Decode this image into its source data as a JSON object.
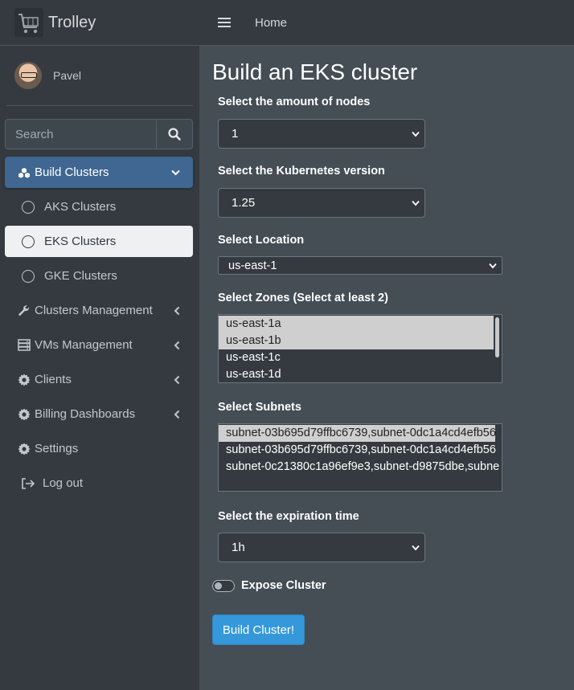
{
  "app": {
    "name": "Trolley"
  },
  "user": {
    "name": "Pavel"
  },
  "search": {
    "placeholder": "Search"
  },
  "sidebar": {
    "items": [
      {
        "label": "Build Clusters",
        "icon": "cubes-icon"
      },
      {
        "label": "AKS Clusters",
        "icon": "circle-icon"
      },
      {
        "label": "EKS Clusters",
        "icon": "circle-icon"
      },
      {
        "label": "GKE Clusters",
        "icon": "circle-icon"
      },
      {
        "label": "Clusters Management",
        "icon": "wrench-icon"
      },
      {
        "label": "VMs Management",
        "icon": "server-icon"
      },
      {
        "label": "Clients",
        "icon": "gear-icon"
      },
      {
        "label": "Billing Dashboards",
        "icon": "gear-icon"
      },
      {
        "label": "Settings",
        "icon": "gear-icon"
      },
      {
        "label": "Log out",
        "icon": "logout-icon"
      }
    ]
  },
  "topbar": {
    "home": "Home"
  },
  "page": {
    "title": "Build an EKS cluster",
    "nodes": {
      "label": "Select the amount of nodes",
      "value": "1"
    },
    "version": {
      "label": "Select the Kubernetes version",
      "value": "1.25"
    },
    "location": {
      "label": "Select Location",
      "value": "us-east-1"
    },
    "zones": {
      "label": "Select Zones (Select at least 2)",
      "options": [
        "us-east-1a",
        "us-east-1b",
        "us-east-1c",
        "us-east-1d"
      ]
    },
    "subnets": {
      "label": "Select Subnets",
      "options": [
        "subnet-03b695d79ffbc6739,subnet-0dc1a4cd4efb56",
        "subnet-03b695d79ffbc6739,subnet-0dc1a4cd4efb56",
        "subnet-0c21380c1a96ef9e3,subnet-d9875dbe,subne"
      ]
    },
    "expiration": {
      "label": "Select the expiration time",
      "value": "1h"
    },
    "expose": {
      "label": "Expose Cluster"
    },
    "submit": "Build Cluster!"
  },
  "colors": {
    "sidebar_bg": "#343a40",
    "content_bg": "#454d55",
    "active_nav": "#3f6791",
    "button_primary": "#3498db"
  }
}
